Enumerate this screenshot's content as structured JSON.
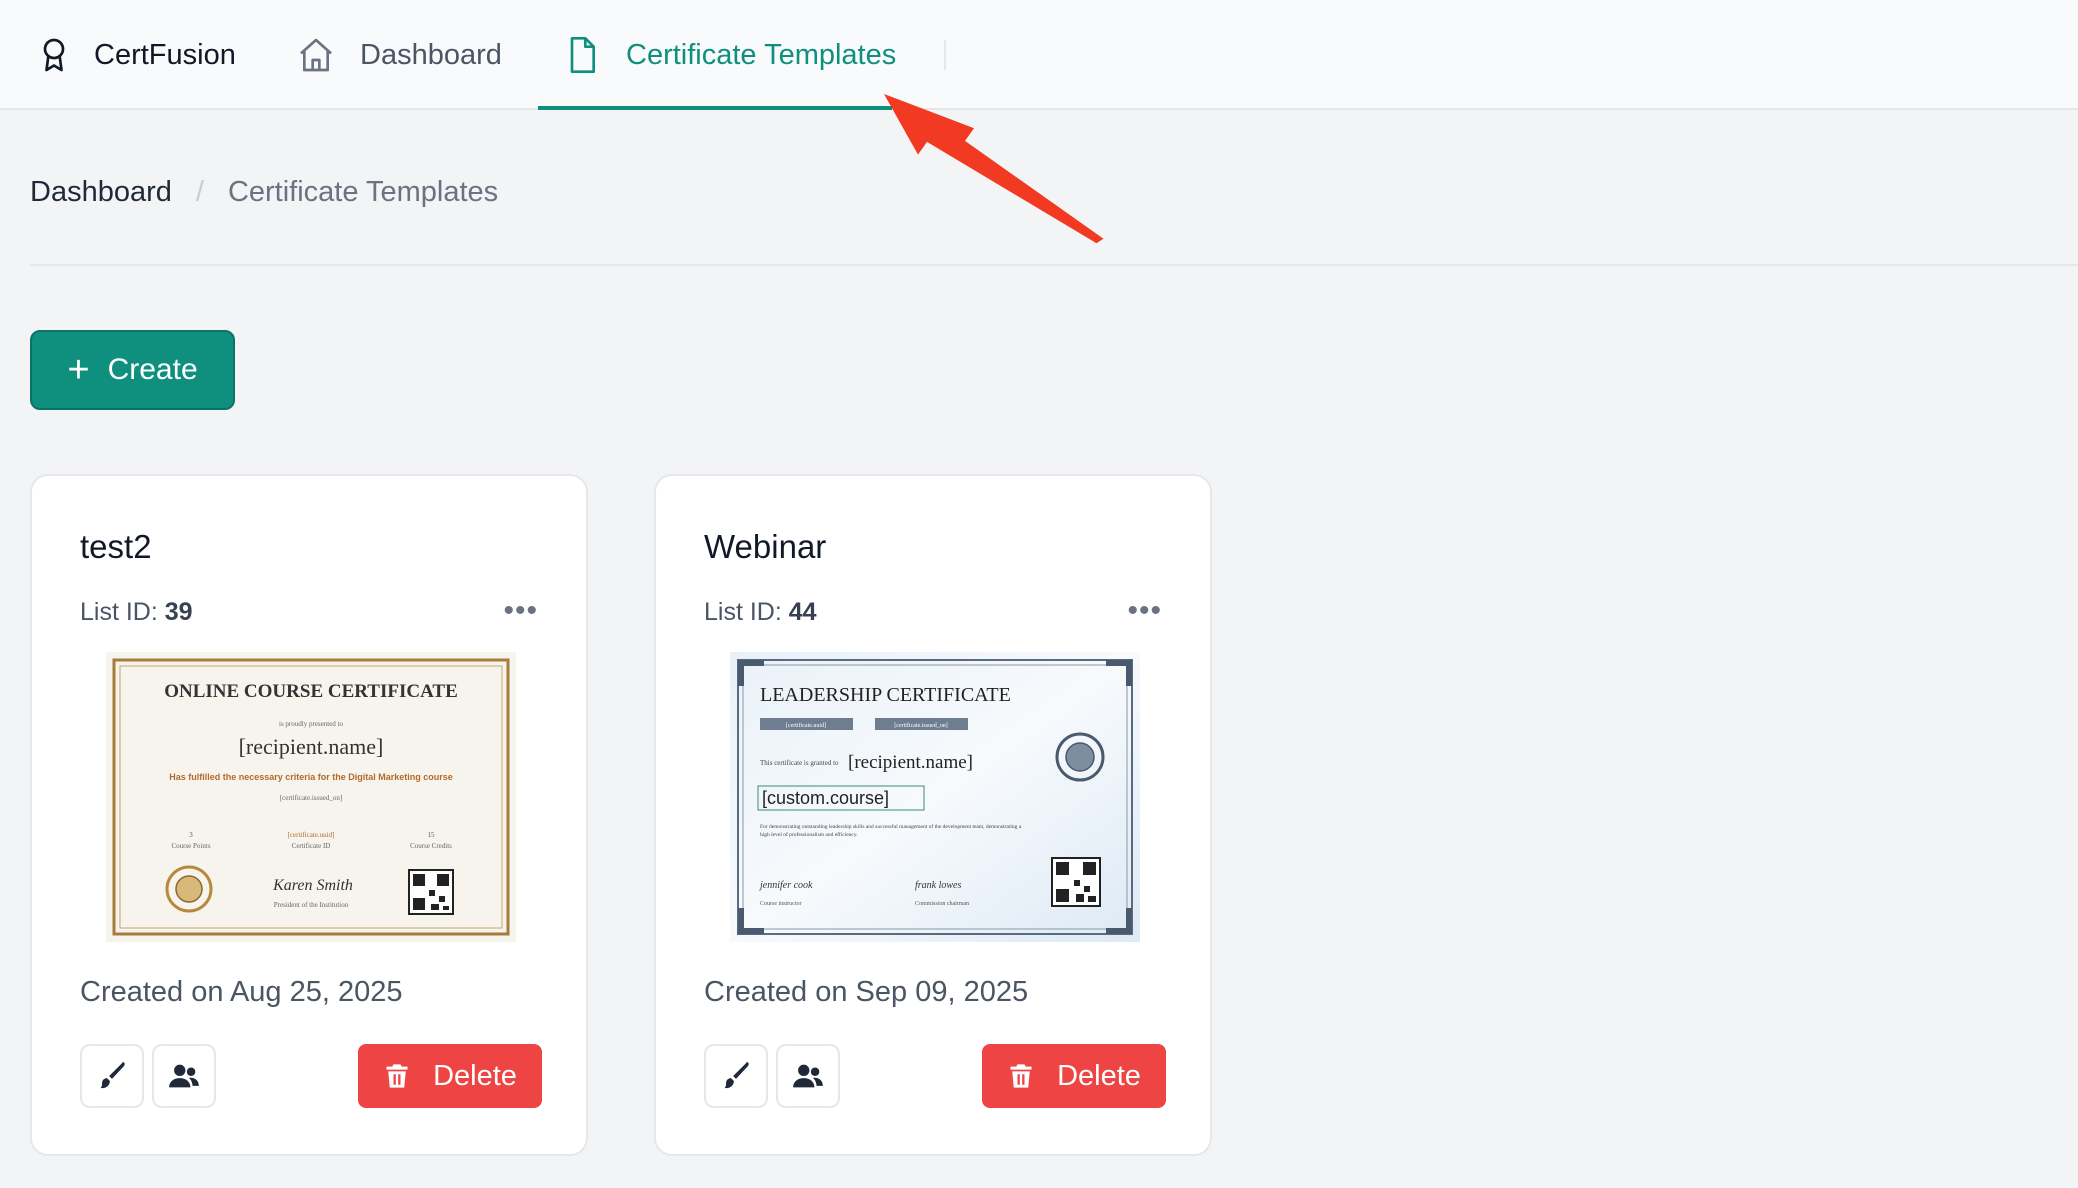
{
  "app": {
    "name": "CertFusion"
  },
  "nav": {
    "dashboard": "Dashboard",
    "templates": "Certificate Templates",
    "accent": "#0f8f7e"
  },
  "breadcrumb": {
    "home": "Dashboard",
    "separator": "/",
    "current": "Certificate Templates"
  },
  "actions": {
    "create_label": "Create"
  },
  "cards": [
    {
      "title": "test2",
      "list_id_label": "List ID: ",
      "list_id": "39",
      "created": "Created on Aug 25, 2025",
      "delete_label": "Delete",
      "preview": {
        "heading": "ONLINE COURSE CERTIFICATE",
        "granted": "is proudly presented to",
        "recipient": "[recipient.name]",
        "body": "Has fulfilled the necessary criteria for the Digital Marketing course",
        "issued": "[certificate.issued_on]",
        "points_value": "3",
        "points_label": "Course Points",
        "uuid": "[certificate.uuid]",
        "uuid_label": "Certificate ID",
        "credits_value": "15",
        "credits_label": "Course Credits",
        "signature": "Karen Smith",
        "signer": "President of the Institution"
      }
    },
    {
      "title": "Webinar",
      "list_id_label": "List ID: ",
      "list_id": "44",
      "created": "Created on Sep 09, 2025",
      "delete_label": "Delete",
      "preview": {
        "heading": "LEADERSHIP CERTIFICATE",
        "field1": "[certificate.uuid]",
        "field2": "[certificate.issued_on]",
        "granted": "This certificate is granted to",
        "recipient": "[recipient.name]",
        "course": "[custom.course]",
        "body1": "For demonstrating outstanding leadership skills and successful management of the development team, demonstrating a",
        "body2": "high level of professionalism and efficiency.",
        "sig1": "jennifer cook",
        "sig1_role": "Course instructor",
        "sig2": "frank lowes",
        "sig2_role": "Commission chairman"
      }
    }
  ],
  "icons": [
    "award-icon",
    "home-icon",
    "file-icon",
    "plus-icon",
    "more-icon",
    "brush-icon",
    "users-icon",
    "trash-icon"
  ],
  "colors": {
    "danger": "#ef4444",
    "annotation_arrow": "#f23a22"
  }
}
